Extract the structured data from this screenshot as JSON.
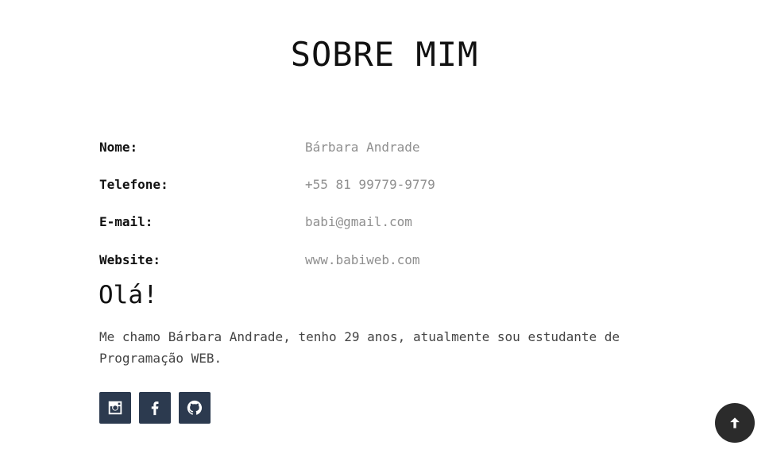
{
  "header": {
    "title": "SOBRE MIM"
  },
  "info": [
    {
      "label": "Nome:",
      "value": "Bárbara Andrade"
    },
    {
      "label": "Telefone:",
      "value": "+55 81 99779-9779"
    },
    {
      "label": "E-mail:",
      "value": "babi@gmail.com"
    },
    {
      "label": "Website:",
      "value": "www.babiweb.com"
    }
  ],
  "about": {
    "greeting": "Olá!",
    "bio": "Me chamo Bárbara Andrade, tenho 29 anos, atualmente sou estudante de Programação WEB."
  },
  "social": {
    "icons": [
      "instagram-icon",
      "facebook-icon",
      "github-icon"
    ],
    "color": "#2c3a4f"
  },
  "back_to_top": {
    "icon": "arrow-up-icon",
    "color": "#2b2b2b"
  }
}
